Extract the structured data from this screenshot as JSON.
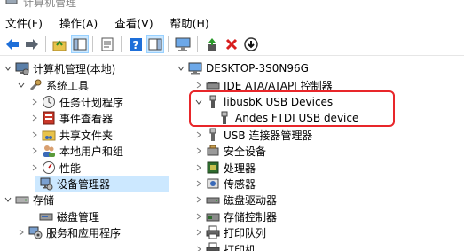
{
  "window": {
    "title": "计算机管理"
  },
  "menu": [
    {
      "label": "文件(F)"
    },
    {
      "label": "操作(A)"
    },
    {
      "label": "查看(V)"
    },
    {
      "label": "帮助(H)"
    }
  ],
  "toolbar": {
    "buttons": [
      {
        "icon": "back-arrow-icon"
      },
      {
        "icon": "forward-arrow-icon"
      },
      {
        "icon": "up-folder-icon"
      },
      {
        "icon": "show-hide-tree-icon"
      },
      {
        "icon": "properties-icon"
      },
      {
        "icon": "help-icon"
      },
      {
        "icon": "action-pane-icon"
      },
      {
        "icon": "monitor-icon"
      },
      {
        "icon": "update-driver-icon"
      },
      {
        "icon": "uninstall-device-icon"
      },
      {
        "icon": "scan-hardware-icon"
      }
    ]
  },
  "left_tree": [
    {
      "label": "计算机管理(本地)",
      "icon": "computer-management-icon",
      "expanded": true
    },
    {
      "label": "系统工具",
      "icon": "tools-icon",
      "expanded": true
    },
    {
      "label": "任务计划程序",
      "icon": "clock-icon",
      "expanded": false
    },
    {
      "label": "事件查看器",
      "icon": "event-viewer-icon",
      "expanded": false
    },
    {
      "label": "共享文件夹",
      "icon": "shared-folder-icon",
      "expanded": false
    },
    {
      "label": "本地用户和组",
      "icon": "users-icon",
      "expanded": false
    },
    {
      "label": "性能",
      "icon": "performance-icon",
      "expanded": false
    },
    {
      "label": "设备管理器",
      "icon": "device-manager-icon",
      "selected": true
    },
    {
      "label": "存储",
      "icon": "storage-icon",
      "expanded": true
    },
    {
      "label": "磁盘管理",
      "icon": "disk-management-icon"
    },
    {
      "label": "服务和应用程序",
      "icon": "services-icon",
      "expanded": false
    }
  ],
  "right_tree": [
    {
      "label": "DESKTOP-3S0N96G",
      "icon": "computer-icon",
      "expanded": true
    },
    {
      "label": "IDE ATA/ATAPI 控制器",
      "icon": "ide-controller-icon",
      "expanded": false
    },
    {
      "label": "libusbK USB Devices",
      "icon": "usb-icon",
      "expanded": true
    },
    {
      "label": "Andes FTDI USB device",
      "icon": "usb-device-icon"
    },
    {
      "label": "USB 连接器管理器",
      "icon": "usb-connector-icon",
      "expanded": false
    },
    {
      "label": "安全设备",
      "icon": "security-device-icon",
      "expanded": false
    },
    {
      "label": "处理器",
      "icon": "processor-icon",
      "expanded": false
    },
    {
      "label": "传感器",
      "icon": "sensor-icon",
      "expanded": false
    },
    {
      "label": "磁盘驱动器",
      "icon": "disk-drive-icon",
      "expanded": false
    },
    {
      "label": "存储控制器",
      "icon": "storage-controller-icon",
      "expanded": false
    },
    {
      "label": "打印队列",
      "icon": "print-queue-icon",
      "expanded": false
    },
    {
      "label": "打印机",
      "icon": "printer-icon",
      "expanded": false
    }
  ],
  "colors": {
    "selection": "#cce8ff",
    "highlight_box": "#e8262a",
    "toolbar_blue": "#1e6fd9",
    "uninstall_red": "#d81e1e"
  }
}
